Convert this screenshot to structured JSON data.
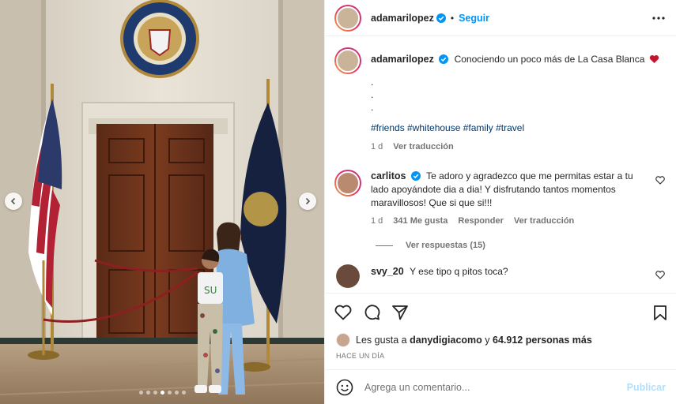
{
  "post": {
    "author": "adamarilopez",
    "follow_label": "Seguir",
    "bullet": "•",
    "more_icon": "more-options-icon"
  },
  "caption": {
    "username": "adamarilopez",
    "text": "Conociendo un poco más de La Casa Blanca",
    "emoji": "heart-emoji",
    "dots": [
      ".",
      ".",
      "."
    ],
    "hashtags": "#friends #whitehouse #family #travel",
    "time": "1 d",
    "translate": "Ver traducción"
  },
  "comments": [
    {
      "username": "carlitos",
      "text": "Te adoro y agradezco que me permitas estar a tu lado apoyándote dia a dia! Y disfrutando tantos momentos maravillosos! Que si que si!!!",
      "time": "1 d",
      "likes": "341 Me gusta",
      "reply": "Responder",
      "translate": "Ver traducción",
      "view_replies": "Ver respuestas (15)"
    },
    {
      "username": "svy_20",
      "text": "Y ese tipo q pitos toca?"
    }
  ],
  "likes": {
    "prefix": "Les gusta a",
    "user": "danydigiacomo",
    "joiner": "y",
    "count": "64.912 personas más"
  },
  "posted_ago": "HACE UN DÍA",
  "add_comment": {
    "placeholder": "Agrega un comentario...",
    "publish": "Publicar"
  },
  "carousel": {
    "total_slides": 7,
    "active_slide": 4
  },
  "colors": {
    "link_blue": "#0095f6",
    "hashtag": "#00376b",
    "muted": "#737373",
    "publish_disabled": "#b2dffc",
    "heart_red": "#ed4956"
  }
}
